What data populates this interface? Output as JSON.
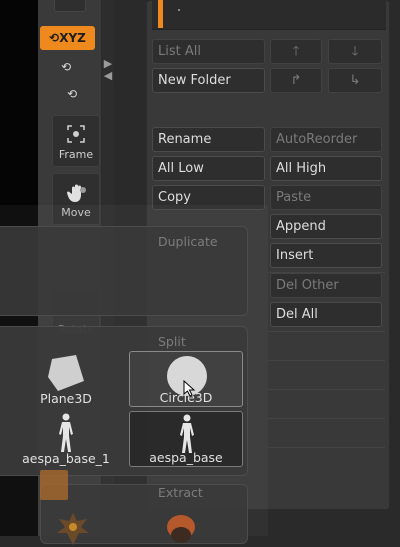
{
  "toolbar": {
    "xyz_label": "XYZ",
    "rot_x": "Q",
    "rot_z": "Z",
    "frame_label": "Frame",
    "move_label": "Move",
    "rotate_label": "Rotate"
  },
  "subtool": {
    "buttons": {
      "list_all": "List All",
      "new_folder": "New Folder",
      "rename": "Rename",
      "auto_reorder": "AutoReorder",
      "all_low": "All Low",
      "all_high": "All High",
      "copy": "Copy",
      "paste": "Paste",
      "duplicate": "Duplicate",
      "append": "Append",
      "insert": "Insert",
      "del_other": "Del Other",
      "del_all": "Del All",
      "split": "Split",
      "extract": "Extract"
    },
    "arrows": {
      "up": "🡑",
      "down": "🡓",
      "move_right": "↱",
      "move_down": "↳"
    }
  },
  "popup": {
    "tiles": [
      {
        "label": "Plane3D",
        "icon": "plane3d-thumbnail"
      },
      {
        "label": "Circle3D",
        "icon": "circle3d-thumbnail"
      },
      {
        "label": "aespa_base_1",
        "icon": "figure-thumbnail"
      },
      {
        "label": "aespa_base",
        "icon": "figure-thumbnail"
      }
    ]
  },
  "colors": {
    "accent": "#ee8a1d",
    "panel": "#393939",
    "button": "#2e2e2e"
  }
}
